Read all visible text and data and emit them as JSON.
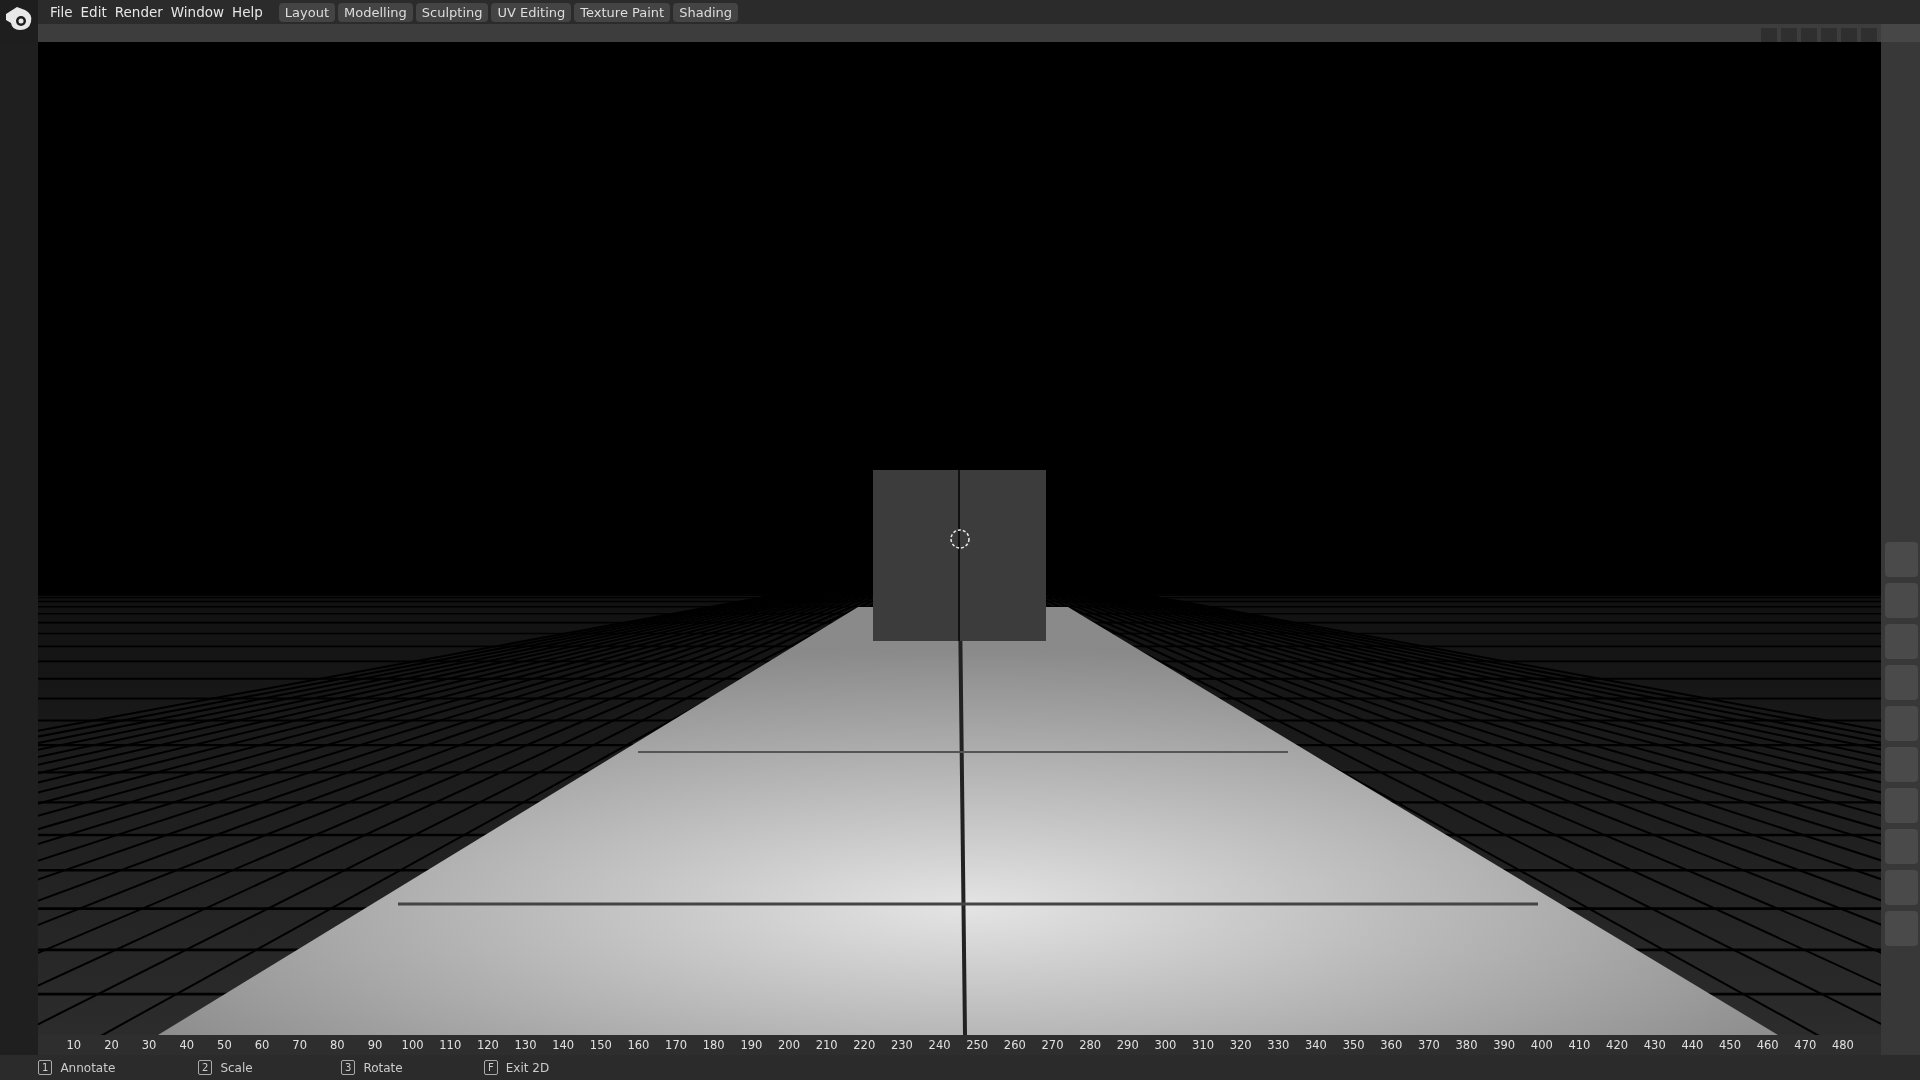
{
  "menu": [
    "File",
    "Edit",
    "Render",
    "Window",
    "Help"
  ],
  "workspace_tabs": [
    "Layout",
    "Modelling",
    "Sculpting",
    "UV Editing",
    "Texture Paint",
    "Shading"
  ],
  "timeline_ruler": [
    "10",
    "20",
    "30",
    "40",
    "50",
    "60",
    "70",
    "80",
    "90",
    "100",
    "110",
    "120",
    "130",
    "140",
    "150",
    "160",
    "170",
    "180",
    "190",
    "200",
    "210",
    "220",
    "230",
    "240",
    "250",
    "260",
    "270",
    "280",
    "290",
    "300",
    "310",
    "320",
    "330",
    "340",
    "350",
    "360",
    "370",
    "380",
    "390",
    "400",
    "410",
    "420",
    "430",
    "440",
    "450",
    "460",
    "470",
    "480"
  ],
  "status_bar": [
    {
      "key": "1",
      "label": "Annotate"
    },
    {
      "key": "2",
      "label": "Scale"
    },
    {
      "key": "3",
      "label": "Rotate"
    },
    {
      "key": "F",
      "label": "Exit 2D"
    }
  ]
}
